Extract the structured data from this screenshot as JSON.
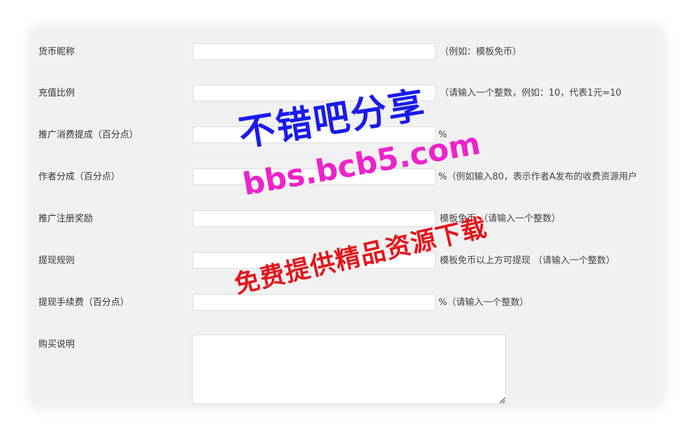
{
  "form": {
    "rows": [
      {
        "label": "货币昵称",
        "value": "",
        "hint": "（例如：模板免币）"
      },
      {
        "label": "充值比例",
        "value": "",
        "hint": "（请输入一个整数，例如：10，代表1元=10"
      },
      {
        "label": "推广消费提成（百分点）",
        "value": "",
        "hint": "%"
      },
      {
        "label": "作者分成（百分点）",
        "value": "",
        "hint": "%（例如输入80，表示作者A发布的收费资源用户"
      },
      {
        "label": "推广注册奖励",
        "value": "",
        "hint": "模板免币 （请输入一个整数）"
      },
      {
        "label": "提现规则",
        "value": "",
        "hint": "模板免币以上方可提现 （请输入一个整数）"
      },
      {
        "label": "提现手续费（百分点）",
        "value": "",
        "hint": "%（请输入一个整数）"
      },
      {
        "label": "购买说明",
        "value": ""
      }
    ]
  },
  "watermark": {
    "line1": "不错吧分享",
    "line2": "bbs.bcb5.com",
    "line3": "免费提供精品资源下载",
    "colors": {
      "line1": "#1a1aee",
      "line2": "#ee22cc",
      "line3": "#e4161c"
    }
  },
  "colors": {
    "panel_background": "#f1f1f1",
    "input_border": "#dddddd"
  }
}
